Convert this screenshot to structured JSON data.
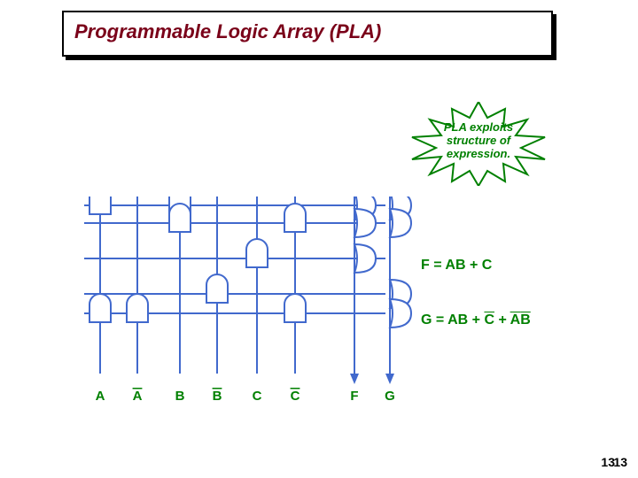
{
  "title": "Programmable Logic Array (PLA)",
  "burst": {
    "line1": "PLA exploits",
    "line2": "structure of",
    "line3": "expression."
  },
  "outputs": {
    "F": {
      "text": "F = AB + C"
    },
    "G": {
      "prefix": "G = AB + ",
      "c": "C",
      "plus": " + ",
      "a": "A",
      "b": "B"
    }
  },
  "columns": {
    "A": "A",
    "Abar": "A",
    "B": "B",
    "Bbar": "B",
    "C": "C",
    "Cbar": "C",
    "F": "F",
    "G": "G"
  },
  "slide_number": "13",
  "slide_number2": "13"
}
